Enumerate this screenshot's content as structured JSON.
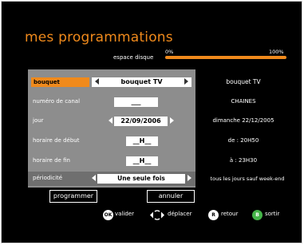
{
  "header": {
    "title": "mes programmations",
    "disk_label": "espace disque",
    "disk_min": "0%",
    "disk_max": "100%",
    "disk_fill": 1.0
  },
  "fields": [
    {
      "label": "bouquet",
      "value": "bouquet TV",
      "info": "bouquet TV"
    },
    {
      "label": "numéro de canal",
      "value": "___",
      "info": "CHAINES"
    },
    {
      "label": "jour",
      "value": "22/09/2006",
      "info": "dimanche 22/12/2005"
    },
    {
      "label": "horaire de début",
      "value": "__H__",
      "info": "de : 20H50"
    },
    {
      "label": "horaire de fin",
      "value": "__H__",
      "info": "à : 23H30"
    },
    {
      "label": "périodicité",
      "value": "Une seule fois",
      "info": "tous les jours sauf week-end"
    }
  ],
  "buttons": {
    "program": "programmer",
    "cancel": "annuler"
  },
  "legend": {
    "ok_key": "OK",
    "ok_label": "valider",
    "move_label": "déplacer",
    "r_key": "R",
    "r_label": "retour",
    "b_key": "B",
    "b_label": "sortir"
  },
  "colors": {
    "accent": "#f08a1c",
    "panel": "#8d8d8d",
    "exit": "#44b548"
  }
}
